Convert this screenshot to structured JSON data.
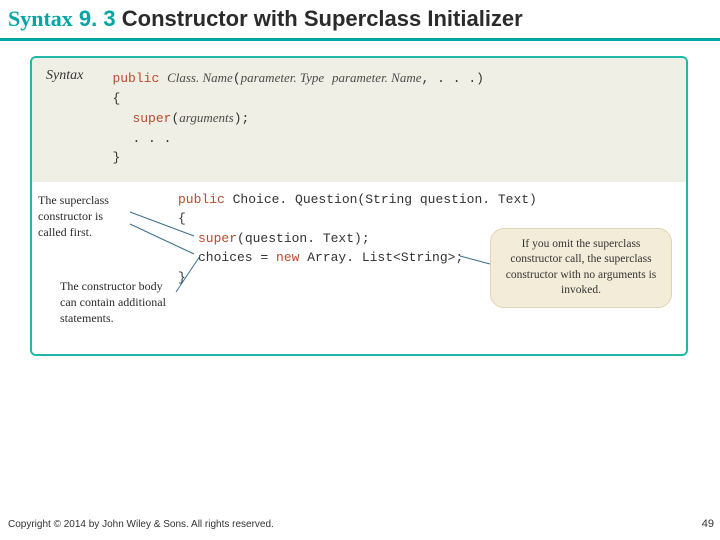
{
  "title": {
    "syntax": "Syntax",
    "num": "9. 3",
    "rest": "Constructor with Superclass Initializer"
  },
  "syntax_box": {
    "label": "Syntax",
    "line1_public": "public",
    "line1_classname": "Class. Name",
    "line1_lp": "(",
    "line1_ptype": "parameter. Type",
    "line1_space": " ",
    "line1_pname": "parameter. Name",
    "line1_rest": ", . . .)",
    "line2": "{",
    "line3_super": "super",
    "line3_lp": "(",
    "line3_args": "arguments",
    "line3_rp": ");",
    "line4": ". . .",
    "line5": "}"
  },
  "example": {
    "line1_public": "public",
    "line1_rest": " Choice. Question(String question. Text)",
    "line2": "{",
    "line3_super": "super",
    "line3_rest": "(question. Text);",
    "line4_lhs": "choices = ",
    "line4_new": "new",
    "line4_rhs": " Array. List<String>;",
    "line5": "}"
  },
  "notes": {
    "first_call": "The superclass constructor is called first.",
    "body_contain": "The constructor body can contain additional statements.",
    "omit": "If you omit the superclass constructor call, the superclass constructor with no arguments is invoked."
  },
  "footer": {
    "copyright": "Copyright © 2014 by John Wiley & Sons. All rights reserved.",
    "page": "49"
  }
}
